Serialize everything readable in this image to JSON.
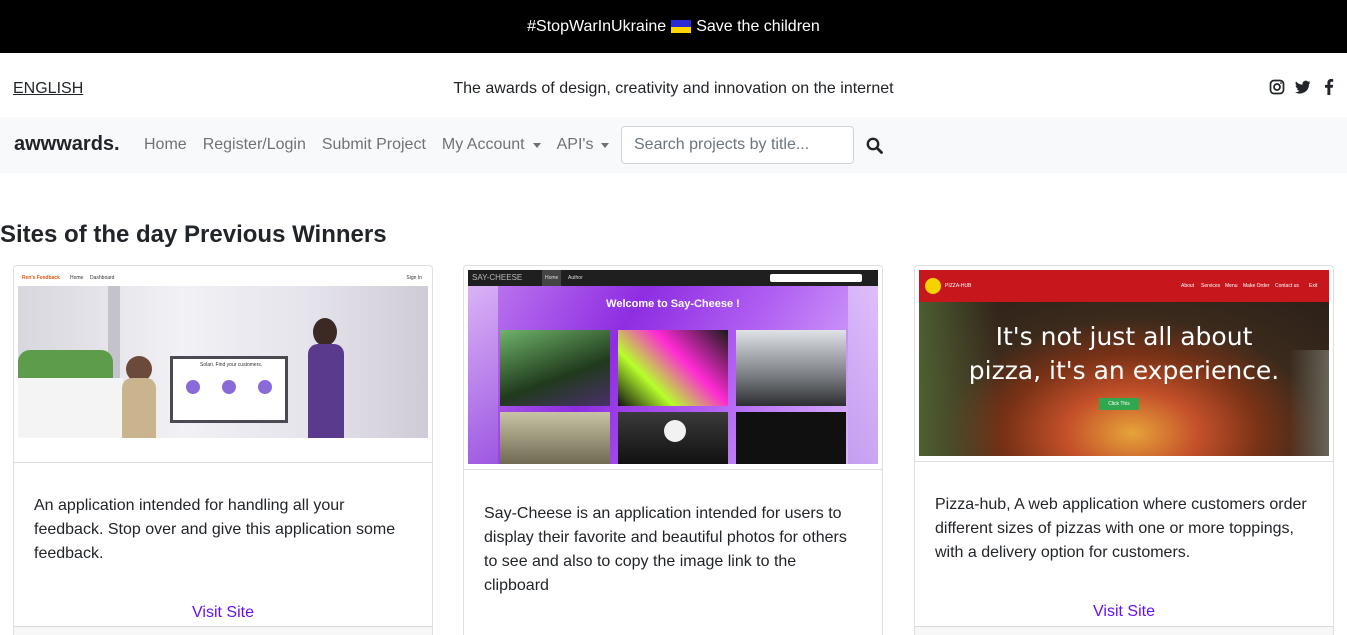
{
  "banner": {
    "text_left": "#StopWarInUkraine",
    "text_right": "Save the children",
    "flag_colors": [
      "#2b2bd6",
      "#ffd700"
    ]
  },
  "topbar": {
    "language": "ENGLISH",
    "tagline": "The awards of design, creativity and innovation on the internet",
    "social_icons": [
      "instagram-icon",
      "twitter-icon",
      "facebook-icon"
    ]
  },
  "navbar": {
    "brand": "awwwards.",
    "links": [
      "Home",
      "Register/Login",
      "Submit Project"
    ],
    "dropdowns": [
      "My Account",
      "API's"
    ],
    "search_placeholder": "Search projects by title...",
    "search_icon": "search-icon"
  },
  "section": {
    "title_bold": "Sites of the day",
    "title_rest": "Previous Winners"
  },
  "cards": [
    {
      "description": "An application intended for handling all your feedback. Stop over and give this application some feedback.",
      "link_label": "Visit Site",
      "screenshot": {
        "nav_brand": "Ren's Feedback",
        "nav_items": [
          "Home",
          "Dashboard"
        ],
        "nav_right": "Sign In",
        "board_title": "Solari. Find your customers."
      }
    },
    {
      "description": "Say-Cheese is an application intended for users to display their favorite and beautiful photos for others to see and also to copy the image link to the clipboard",
      "link_label": "Visit Site",
      "screenshot": {
        "nav_brand": "SAY-CHEESE",
        "nav_items": [
          "Home",
          "Author"
        ],
        "hero_title": "Welcome to Say-Cheese !"
      }
    },
    {
      "description": "Pizza-hub, A web application where customers order different sizes of pizzas with one or more toppings, with a delivery option for customers.",
      "link_label": "Visit Site",
      "screenshot": {
        "nav_brand": "PIZZA-HUB",
        "nav_items": [
          "About",
          "Services",
          "Menu",
          "Make Order",
          "Contact us",
          "Exit"
        ],
        "hero_line1": "It's not just all about",
        "hero_line2": "pizza, it's an experience.",
        "cta": "Click This"
      }
    }
  ]
}
